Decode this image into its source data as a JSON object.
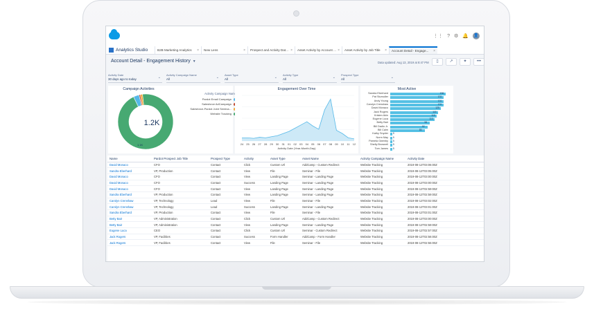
{
  "header": {
    "app_name": "Analytics Studio",
    "avatar_initial": "",
    "icons": [
      "grid-icon",
      "help-icon",
      "gear-icon",
      "bell-icon",
      "avatar"
    ]
  },
  "tabs": [
    {
      "label": "B2B Marketing Analytics",
      "active": false
    },
    {
      "label": "New Lens",
      "active": false
    },
    {
      "label": "Prospect and Activity Dat...",
      "active": false
    },
    {
      "label": "Asset Activity by Account ...",
      "active": false
    },
    {
      "label": "Asset Activity by Job Title",
      "active": false
    },
    {
      "label": "Account Detail - Engage...",
      "active": true
    }
  ],
  "dashboard": {
    "title": "Account Detail - Engagement History",
    "updated": "Data updated: Aug 13, 2019 at 8:47 PM"
  },
  "filters": [
    {
      "label": "Activity Date",
      "value": "30 days ago to today"
    },
    {
      "label": "Activity Campaign Name",
      "value": "All"
    },
    {
      "label": "Asset Type",
      "value": "All"
    },
    {
      "label": "Activity Type",
      "value": "All"
    },
    {
      "label": "Prospect Type",
      "value": "All"
    }
  ],
  "campaign_activities": {
    "title": "Campaign Activities",
    "center_value": "1.2K",
    "segment_label": "1.1K",
    "legend_title": "Activity Campaign Name",
    "legend": [
      {
        "name": "Pardot Email Campaign",
        "color": "#54b8e8"
      },
      {
        "name": "Salesforce AdCampaign",
        "color": "#c2472d"
      },
      {
        "name": "Salesforce-Pardot Joint Semina...",
        "color": "#f2a93b"
      },
      {
        "name": "Website Tracking",
        "color": "#47a972"
      }
    ],
    "values": [
      40,
      10,
      15,
      1135
    ]
  },
  "engagement": {
    "title": "Engagement Over Time",
    "xlabel": "Activity Date (Year-Month-Day)",
    "x_ticks": [
      "24",
      "25",
      "26",
      "27",
      "28",
      "29",
      "30",
      "31",
      "01",
      "02",
      "03",
      "04",
      "05",
      "06",
      "07",
      "08",
      "09",
      "10",
      "11",
      "12"
    ]
  },
  "most_active": {
    "title": "Most Active"
  },
  "chart_data": [
    {
      "type": "pie",
      "title": "Campaign Activities",
      "categories": [
        "Pardot Email Campaign",
        "Salesforce AdCampaign",
        "Salesforce-Pardot Joint Semina...",
        "Website Tracking"
      ],
      "values": [
        40,
        10,
        15,
        1135
      ],
      "colors": [
        "#54b8e8",
        "#c2472d",
        "#f2a93b",
        "#47a972"
      ],
      "center_label": "1.2K",
      "legend": "top-right"
    },
    {
      "type": "area",
      "title": "Engagement Over Time",
      "xlabel": "Activity Date (Year-Month-Day)",
      "x": [
        "24",
        "25",
        "26",
        "27",
        "28",
        "29",
        "30",
        "31",
        "01",
        "02",
        "03",
        "04",
        "05",
        "06",
        "07",
        "08",
        "09",
        "10",
        "11",
        "12"
      ],
      "values": [
        6,
        6,
        5,
        7,
        6,
        8,
        10,
        14,
        18,
        24,
        30,
        36,
        28,
        22,
        58,
        78,
        20,
        14,
        6,
        4
      ],
      "ylim": [
        0,
        85
      ],
      "color": "#54b8e8"
    },
    {
      "type": "bar",
      "title": "Most Active",
      "categories": [
        "Sandra Eberhard",
        "Pat Stumuller",
        "Andy Young",
        "Carolyn Crenshaw",
        "David Monaco",
        "Jack Rogers",
        "Kristen Akin",
        "Eugene Luca",
        "Betty Bair",
        "Bill Dadio Jr.",
        "Bill Calm",
        "Kathy Snyder",
        "Norm May",
        "Pamela Owenby",
        "Shelly Brownell",
        "Tom James"
      ],
      "values": [
        136,
        131,
        131,
        131,
        125,
        118,
        115,
        110,
        98,
        92,
        85,
        5,
        5,
        5,
        5,
        5
      ],
      "xlim": [
        0,
        140
      ],
      "color": "#55c0e4"
    }
  ],
  "table": {
    "columns": [
      "Name",
      "Pardot Prospect Job Title",
      "Prospect Type",
      "Activity",
      "Asset Type",
      "Asset Name",
      "Activity Campaign Name",
      "Activity Date"
    ],
    "rows": [
      [
        "David Monaco",
        "CFO",
        "Contact",
        "Click",
        "Custom Url",
        "AddCamp - Custom Redirect",
        "Website Tracking",
        "2019-08-12T03:06:00Z"
      ],
      [
        "Sandra Eberhard",
        "VP, Production",
        "Contact",
        "View",
        "File",
        "Seminar - File",
        "Website Tracking",
        "2019-08-12T03:05:00Z"
      ],
      [
        "David Monaco",
        "CFO",
        "Contact",
        "View",
        "Landing Page",
        "Seminar - Landing Page",
        "Website Tracking",
        "2019-08-12T03:00:00Z"
      ],
      [
        "David Monaco",
        "CFO",
        "Contact",
        "Success",
        "Landing Page",
        "Seminar - Landing Page",
        "Website Tracking",
        "2019-08-12T03:00:00Z"
      ],
      [
        "David Monaco",
        "CFO",
        "Contact",
        "View",
        "Landing Page",
        "Seminar - Landing Page",
        "Website Tracking",
        "2019-08-12T02:59:00Z"
      ],
      [
        "Sandra Eberhard",
        "VP, Production",
        "Contact",
        "View",
        "Landing Page",
        "Seminar - Landing Page",
        "Website Tracking",
        "2019-08-12T02:59:00Z"
      ],
      [
        "Carolyn Crenshaw",
        "VP, Technology",
        "Lead",
        "View",
        "File",
        "Seminar - File",
        "Website Tracking",
        "2019-08-12T03:02:00Z"
      ],
      [
        "Carolyn Crenshaw",
        "VP, Technology",
        "Lead",
        "Success",
        "Landing Page",
        "Seminar - Landing Page",
        "Website Tracking",
        "2019-08-12T03:01:00Z"
      ],
      [
        "Sandra Eberhard",
        "VP, Production",
        "Contact",
        "View",
        "File",
        "Seminar - File",
        "Website Tracking",
        "2019-08-12T03:01:00Z"
      ],
      [
        "Betty Bair",
        "VP, Administration",
        "Contact",
        "Click",
        "Custom Url",
        "AddCamp - Custom Redirect",
        "Website Tracking",
        "2019-08-12T03:00:00Z"
      ],
      [
        "Betty Bair",
        "VP, Administration",
        "Contact",
        "View",
        "Landing Page",
        "Seminar - Landing Page",
        "Website Tracking",
        "2019-08-12T02:59:00Z"
      ],
      [
        "Eugene Luca",
        "CEO",
        "Contact",
        "Click",
        "Custom Url",
        "Seminar - Custom Redirect",
        "Website Tracking",
        "2019-08-12T02:57:00Z"
      ],
      [
        "Jack Rogers",
        "VP, Facilities",
        "Contact",
        "Success",
        "Form Handler",
        "AddCamp - Form Handler",
        "Website Tracking",
        "2019-08-12T02:56:00Z"
      ],
      [
        "Jack Rogers",
        "VP, Facilities",
        "Contact",
        "View",
        "File",
        "Seminar - File",
        "Website Tracking",
        "2019-08-12T02:55:00Z"
      ]
    ]
  }
}
